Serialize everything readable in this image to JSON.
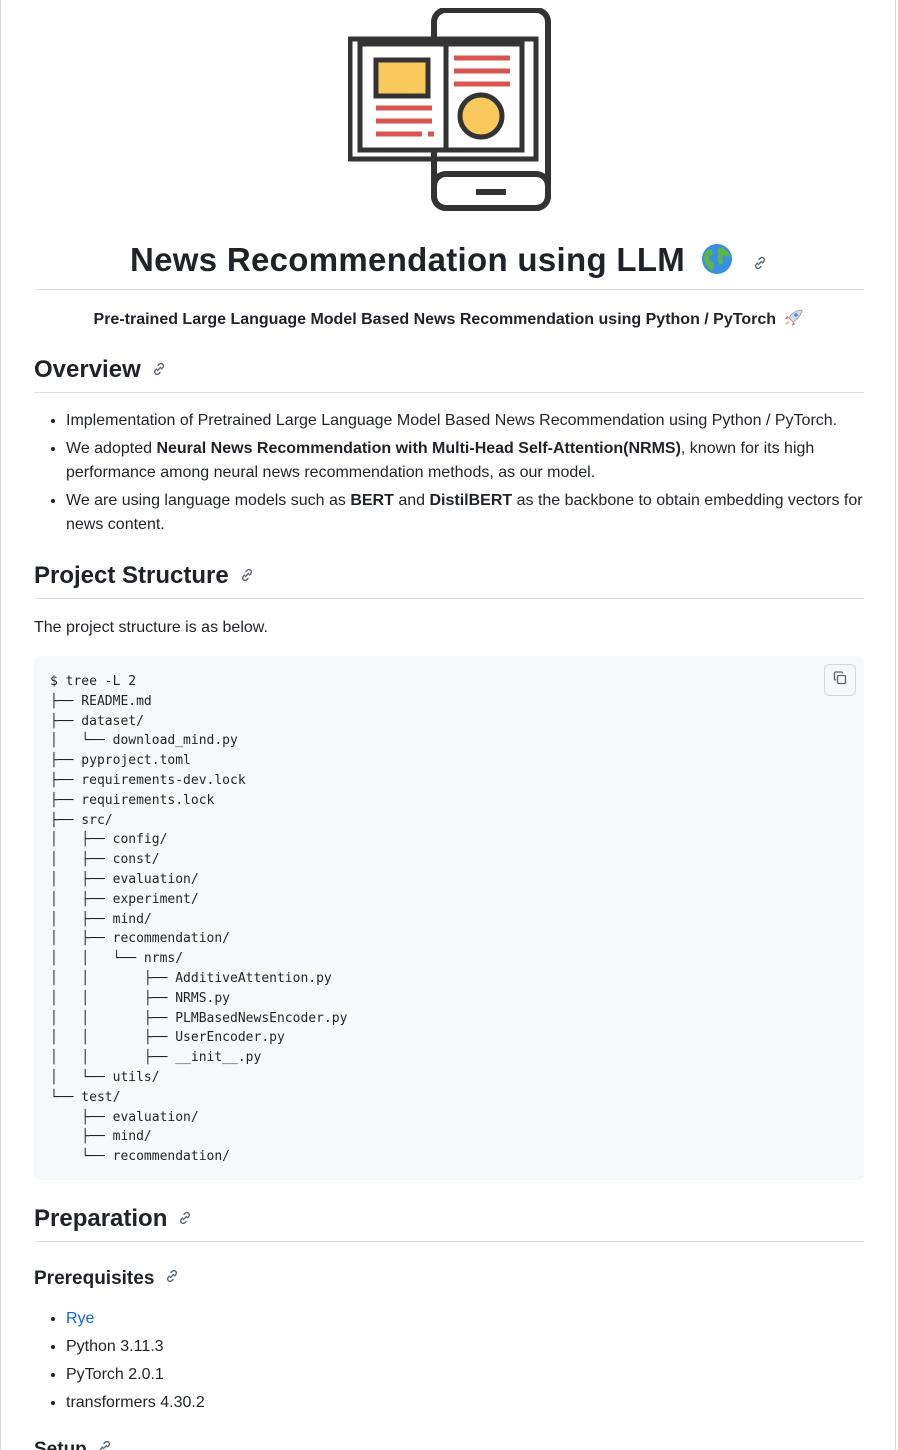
{
  "header": {
    "title": "News Recommendation using LLM",
    "subtitle": "Pre-trained Large Language Model Based News Recommendation using Python / PyTorch",
    "logo_icon": "news-tablet-logo",
    "title_emoji_icon": "globe-icon",
    "subtitle_emoji_icon": "rocket-icon"
  },
  "overview": {
    "heading": "Overview",
    "items": [
      {
        "pre": "Implementation of Pretrained Large Language Model Based News Recommendation using Python / PyTorch.",
        "b1": "",
        "mid": "",
        "b2": "",
        "post": ""
      },
      {
        "pre": "We adopted ",
        "b1": "Neural News Recommendation with Multi-Head Self-Attention(NRMS)",
        "mid": ", known for its high performance among neural news recommendation methods, as our model.",
        "b2": "",
        "post": ""
      },
      {
        "pre": "We are using language models such as ",
        "b1": "BERT",
        "mid": " and ",
        "b2": "DistilBERT",
        "post": " as the backbone to obtain embedding vectors for news content."
      }
    ]
  },
  "project_structure": {
    "heading": "Project Structure",
    "intro": "The project structure is as below.",
    "code": "$ tree -L 2\n├── README.md\n├── dataset/\n│   └── download_mind.py\n├── pyproject.toml\n├── requirements-dev.lock\n├── requirements.lock\n├── src/\n│   ├── config/\n│   ├── const/\n│   ├── evaluation/\n│   ├── experiment/\n│   ├── mind/\n│   ├── recommendation/\n│   │   └── nrms/\n│   │       ├── AdditiveAttention.py\n│   │       ├── NRMS.py\n│   │       ├── PLMBasedNewsEncoder.py\n│   │       ├── UserEncoder.py\n│   │       ├── __init__.py\n│   └── utils/\n└── test/\n    ├── evaluation/\n    ├── mind/\n    └── recommendation/",
    "copy_icon": "copy-icon"
  },
  "preparation": {
    "heading": "Preparation",
    "prereq_heading": "Prerequisites",
    "prereq_link": "Rye",
    "prereqs": [
      "Python 3.11.3",
      "PyTorch 2.0.1",
      "transformers 4.30.2"
    ],
    "setup_heading": "Setup"
  },
  "colors": {
    "logo_dark": "#333333",
    "logo_yellow": "#f9c95e",
    "logo_red": "#d9534f",
    "link": "#0969da",
    "code_bg": "#f6f8fa"
  }
}
